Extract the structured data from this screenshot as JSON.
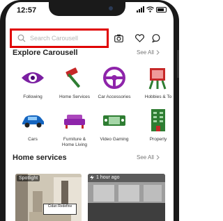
{
  "status_bar": {
    "time": "12:57"
  },
  "search": {
    "placeholder": "Search Carousell"
  },
  "explore": {
    "title": "Explore Carousell",
    "see_all": "See All",
    "categories": [
      {
        "label": "Following",
        "icon": "eye-icon",
        "color": "#7b1fa2"
      },
      {
        "label": "Home Services",
        "icon": "hammer-icon",
        "color": "#2e7d32"
      },
      {
        "label": "Car Accessories",
        "icon": "steering-wheel-icon",
        "color": "#8e24aa"
      },
      {
        "label": "Hobbies & To",
        "icon": "easel-icon",
        "color": "#c62828"
      },
      {
        "label": "Cars",
        "icon": "car-icon",
        "color": "#1565c0"
      },
      {
        "label": "Furniture &\nHome Living",
        "icon": "sofa-icon",
        "color": "#8e24aa"
      },
      {
        "label": "Video Gaming",
        "icon": "game-console-icon",
        "color": "#2e7d32"
      },
      {
        "label": "Property",
        "icon": "building-icon",
        "color": "#2e7d32"
      }
    ]
  },
  "home_services": {
    "title": "Home services",
    "see_all": "See All",
    "cards": [
      {
        "badge": "Spotlight",
        "logo_text": "Cidan Redefine",
        "accent": "#8e24aa"
      },
      {
        "badge": "1 hour ago",
        "accent": "#555555"
      }
    ]
  }
}
